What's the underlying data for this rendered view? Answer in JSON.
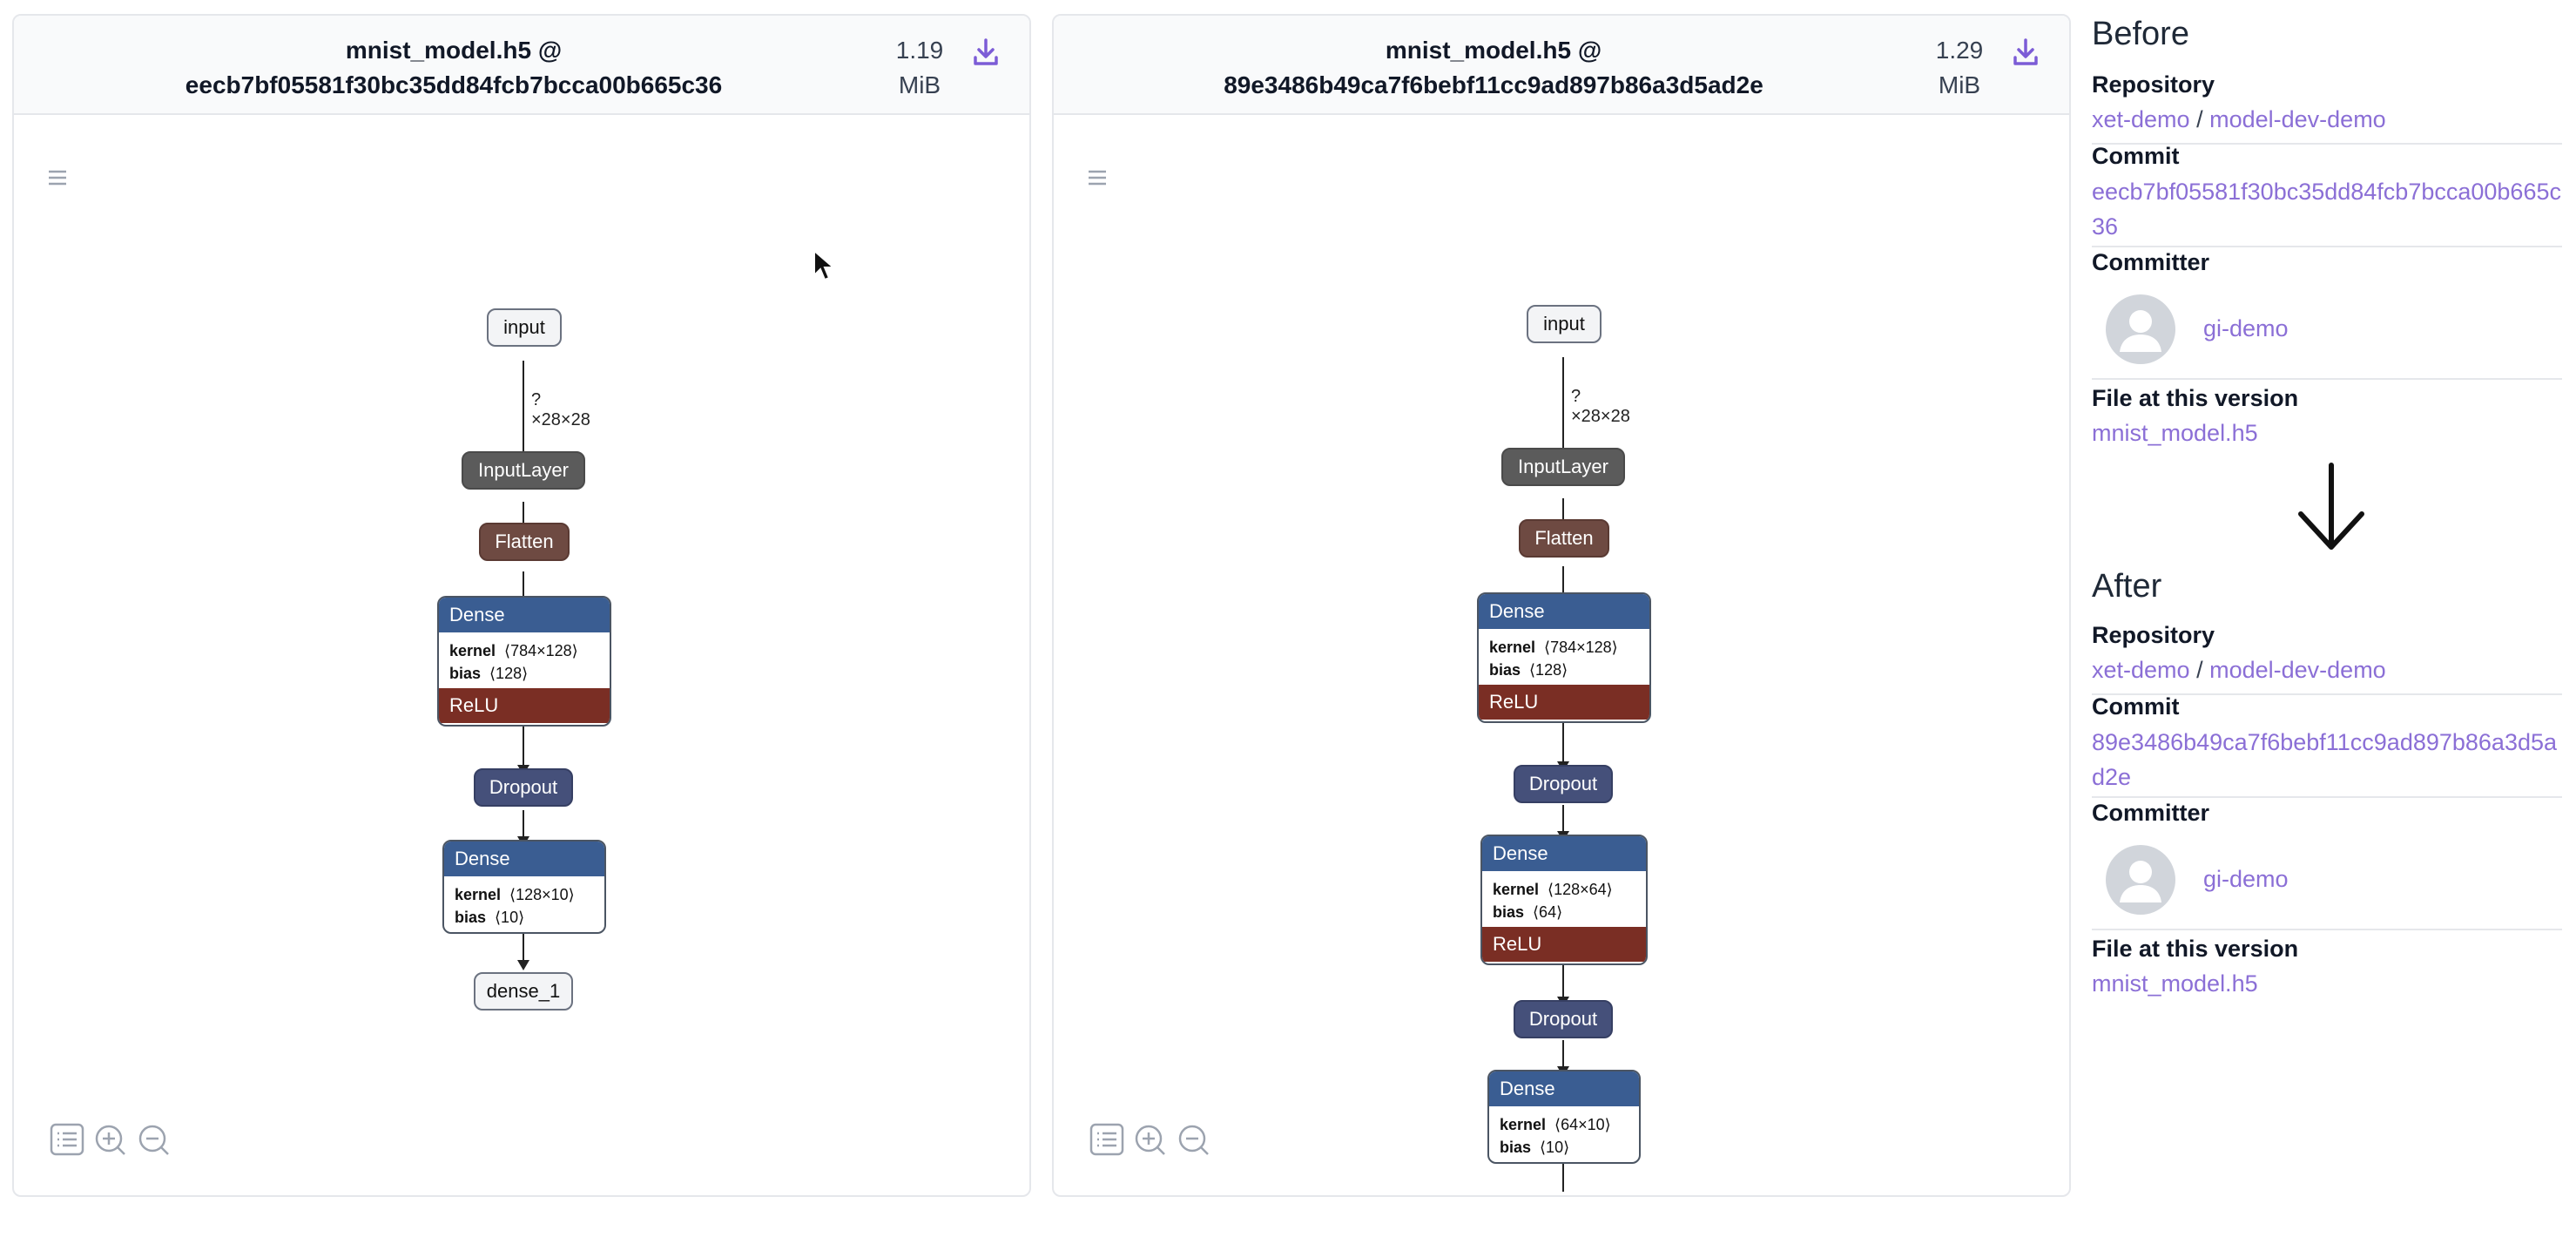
{
  "left_panel": {
    "file_name": "mnist_model.h5 @",
    "commit_hash": "eecb7bf05581f30bc35dd84fcb7bcca00b665c36",
    "size_value": "1.19",
    "size_unit": "MiB",
    "download_icon": "download-icon",
    "menu_icon": "hamburger-icon",
    "graph": {
      "input_label": "input",
      "input_shape": "?×28×28",
      "input_layer": "InputLayer",
      "flatten": "Flatten",
      "dense1": {
        "title": "Dense",
        "kernel_key": "kernel",
        "kernel_val": "⟨784×128⟩",
        "bias_key": "bias",
        "bias_val": "⟨128⟩",
        "activation": "ReLU"
      },
      "dropout1": "Dropout",
      "dense2": {
        "title": "Dense",
        "kernel_key": "kernel",
        "kernel_val": "⟨128×10⟩",
        "bias_key": "bias",
        "bias_val": "⟨10⟩"
      },
      "output": "dense_1"
    }
  },
  "right_panel": {
    "file_name": "mnist_model.h5 @",
    "commit_hash": "89e3486b49ca7f6bebf11cc9ad897b86a3d5ad2e",
    "size_value": "1.29",
    "size_unit": "MiB",
    "download_icon": "download-icon",
    "menu_icon": "hamburger-icon",
    "graph": {
      "input_label": "input",
      "input_shape": "?×28×28",
      "input_layer": "InputLayer",
      "flatten": "Flatten",
      "dense1": {
        "title": "Dense",
        "kernel_key": "kernel",
        "kernel_val": "⟨784×128⟩",
        "bias_key": "bias",
        "bias_val": "⟨128⟩",
        "activation": "ReLU"
      },
      "dropout1": "Dropout",
      "dense2": {
        "title": "Dense",
        "kernel_key": "kernel",
        "kernel_val": "⟨128×64⟩",
        "bias_key": "bias",
        "bias_val": "⟨64⟩",
        "activation": "ReLU"
      },
      "dropout2": "Dropout",
      "dense3": {
        "title": "Dense",
        "kernel_key": "kernel",
        "kernel_val": "⟨64×10⟩",
        "bias_key": "bias",
        "bias_val": "⟨10⟩"
      }
    }
  },
  "sidebar": {
    "before": {
      "heading": "Before",
      "repository_label": "Repository",
      "repo_owner": "xet-demo",
      "repo_sep": "/",
      "repo_name": "model-dev-demo",
      "commit_label": "Commit",
      "commit": "eecb7bf05581f30bc35dd84fcb7bcca00b665c36",
      "committer_label": "Committer",
      "committer": "gi-demo",
      "file_label": "File at this version",
      "file": "mnist_model.h5"
    },
    "after": {
      "heading": "After",
      "repository_label": "Repository",
      "repo_owner": "xet-demo",
      "repo_sep": "/",
      "repo_name": "model-dev-demo",
      "commit_label": "Commit",
      "commit": "89e3486b49ca7f6bebf11cc9ad897b86a3d5ad2e",
      "committer_label": "Committer",
      "committer": "gi-demo",
      "file_label": "File at this version",
      "file": "mnist_model.h5"
    }
  },
  "colors": {
    "link": "#8b6fd6",
    "dense_header": "#3a5d92",
    "relu": "#7a2e24",
    "dropout": "#45507a",
    "flatten": "#6e4a42",
    "input_layer": "#5b5b5b"
  }
}
